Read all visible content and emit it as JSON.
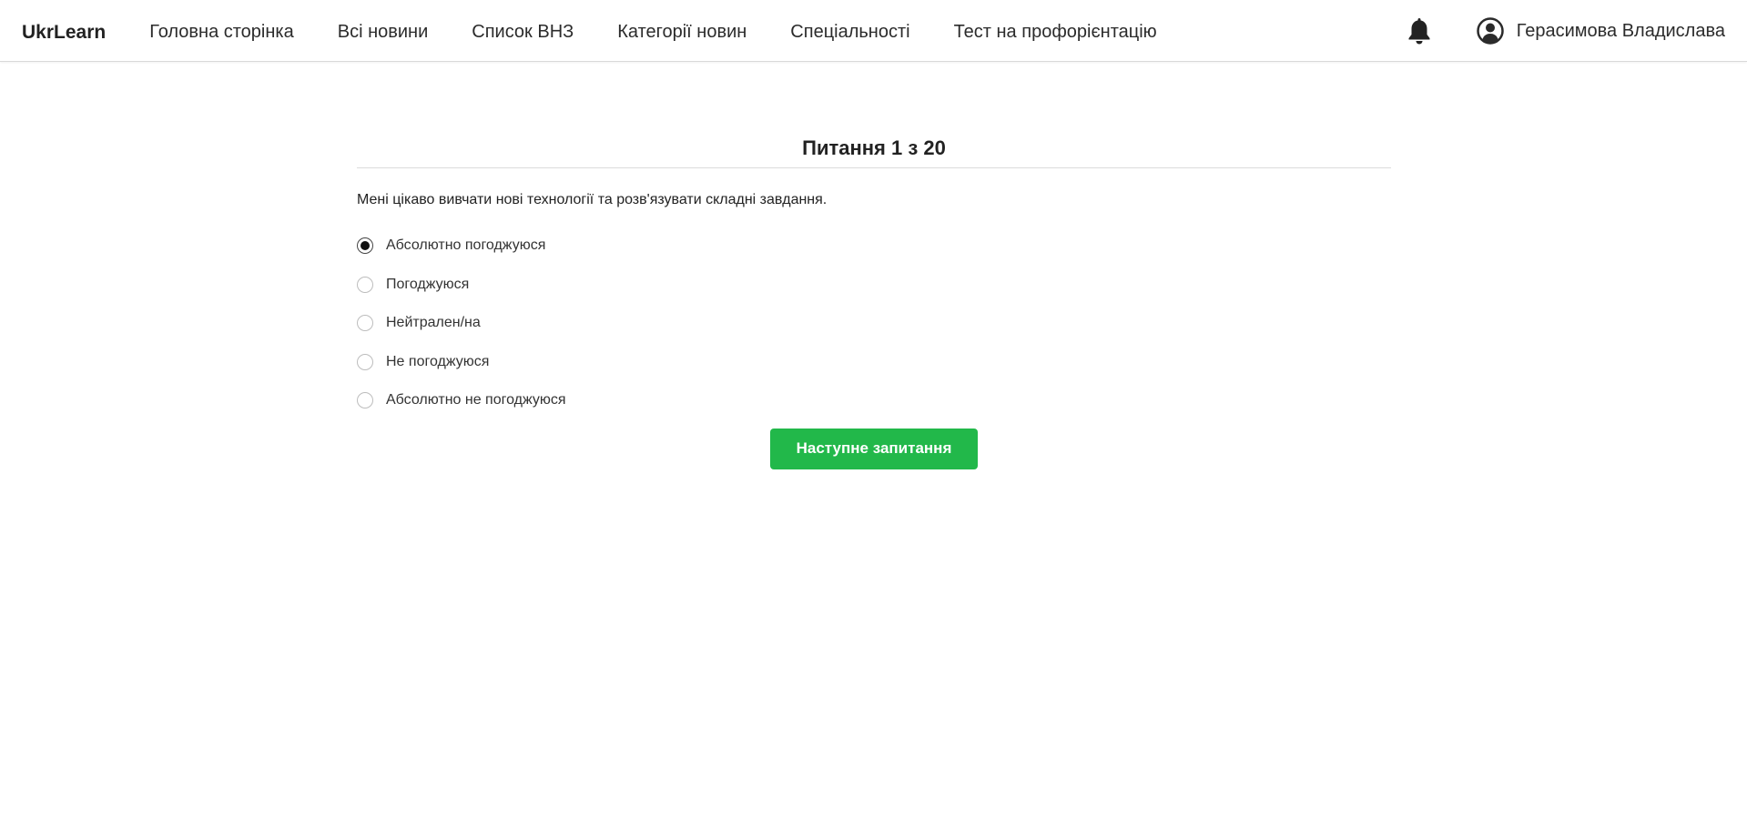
{
  "nav": {
    "brand": "UkrLearn",
    "links": [
      "Головна сторінка",
      "Всі новини",
      "Список ВНЗ",
      "Категорії новин",
      "Спеціальності",
      "Тест на профорієнтацію"
    ],
    "user_name": "Герасимова Владислава",
    "icons": {
      "notifications": "bell-icon",
      "profile": "user-circle-icon"
    }
  },
  "quiz": {
    "title": "Питання 1 з 20",
    "question": "Мені цікаво вивчати нові технології та розв'язувати складні завдання.",
    "options": [
      "Абсолютно погоджуюся",
      "Погоджуюся",
      "Нейтрален/на",
      "Не погоджуюся",
      "Абсолютно не погоджуюся"
    ],
    "selected_option": "Абсолютно погоджуюся",
    "next_label": "Наступне запитання"
  },
  "colors": {
    "accent": "#22b84a",
    "text": "#222222",
    "border": "#d9d9d9"
  }
}
